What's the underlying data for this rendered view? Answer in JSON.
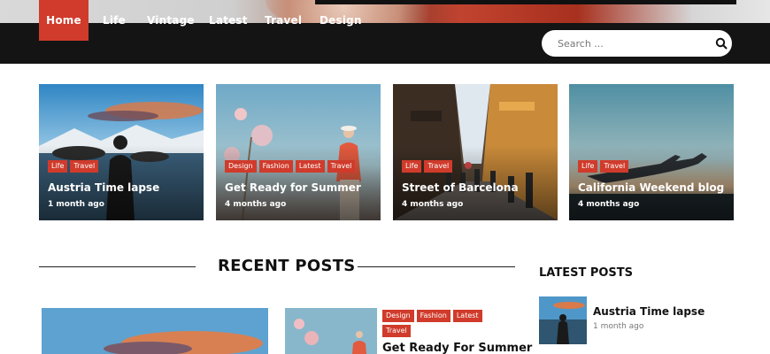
{
  "nav": {
    "items": [
      {
        "label": "Home",
        "active": true
      },
      {
        "label": "Life"
      },
      {
        "label": "Vintage"
      },
      {
        "label": "Latest"
      },
      {
        "label": "Travel"
      },
      {
        "label": "Design"
      }
    ],
    "search_placeholder": "Search ..."
  },
  "featured": [
    {
      "tags": [
        "Life",
        "Travel"
      ],
      "title": "Austria Time lapse",
      "time": "1 month ago"
    },
    {
      "tags": [
        "Design",
        "Fashion",
        "Latest",
        "Travel"
      ],
      "title": "Get Ready for Summer",
      "time": "4 months ago"
    },
    {
      "tags": [
        "Life",
        "Travel"
      ],
      "title": "Street of Barcelona",
      "time": "4 months ago"
    },
    {
      "tags": [
        "Life",
        "Travel"
      ],
      "title": "California Weekend blog",
      "time": "4 months ago"
    }
  ],
  "recent": {
    "heading": "RECENT POSTS",
    "second_post": {
      "tags": [
        "Design",
        "Fashion",
        "Latest",
        "Travel"
      ],
      "title": "Get Ready For Summer"
    }
  },
  "latest": {
    "heading": "LATEST POSTS",
    "items": [
      {
        "title": "Austria Time lapse",
        "time": "1 month ago"
      }
    ]
  },
  "colors": {
    "accent": "#d03b2b",
    "nav_bg": "#141414"
  }
}
